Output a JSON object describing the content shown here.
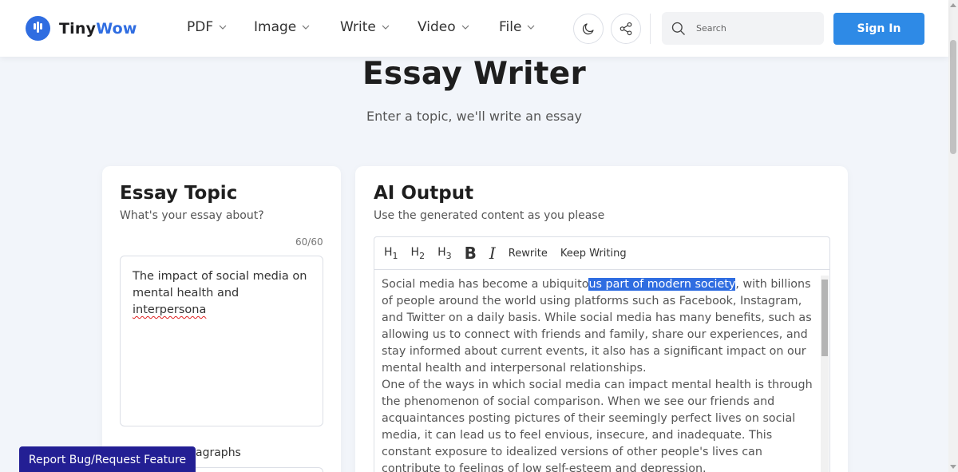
{
  "brand": {
    "name_part1": "Tiny",
    "name_part2": "Wow",
    "color": "#2f6de1"
  },
  "nav": {
    "items": [
      {
        "label": "PDF"
      },
      {
        "label": "Image"
      },
      {
        "label": "Write"
      },
      {
        "label": "Video"
      },
      {
        "label": "File"
      }
    ]
  },
  "header": {
    "theme_icon": "moon-icon",
    "share_icon": "share-icon",
    "search_placeholder": "Search",
    "signin_label": "Sign In",
    "signin_color": "#2e8ae6"
  },
  "hero": {
    "title": "Essay Writer",
    "subtitle": "Enter a topic, we'll write an essay"
  },
  "left_panel": {
    "title": "Essay Topic",
    "subtitle": "What's your essay about?",
    "char_counter": "60/60",
    "topic_text_before": "The impact of social media on mental health and ",
    "topic_text_misspelled": "interpersona",
    "paragraphs_label_visible": "agraphs"
  },
  "right_panel": {
    "title": "AI Output",
    "subtitle": "Use the generated content as you please",
    "toolbar": {
      "h1": "H",
      "h1_sub": "1",
      "h2": "H",
      "h2_sub": "2",
      "h3": "H",
      "h3_sub": "3",
      "bold": "B",
      "italic": "I",
      "rewrite": "Rewrite",
      "keep_writing": "Keep Writing"
    },
    "output": {
      "p1_before": "Social media has become a ubiquito",
      "p1_highlight": "us part of modern society",
      "p1_after": ", with billions of people around the world using platforms such as Facebook, Instagram, and Twitter on a daily basis. While social media has many benefits, such as allowing us to connect with friends and family, share our experiences, and stay informed about current events, it also has a significant impact on our mental health and interpersonal relationships.",
      "p2": "One of the ways in which social media can impact mental health is through the phenomenon of social comparison. When we see our friends and acquaintances posting pictures of their seemingly perfect lives on social media, it can lead us to feel envious, insecure, and inadequate. This constant exposure to idealized versions of other people's lives can contribute to feelings of low self-esteem and depression."
    }
  },
  "report_button": {
    "label": "Report Bug/Request Feature",
    "color": "#231f94"
  }
}
